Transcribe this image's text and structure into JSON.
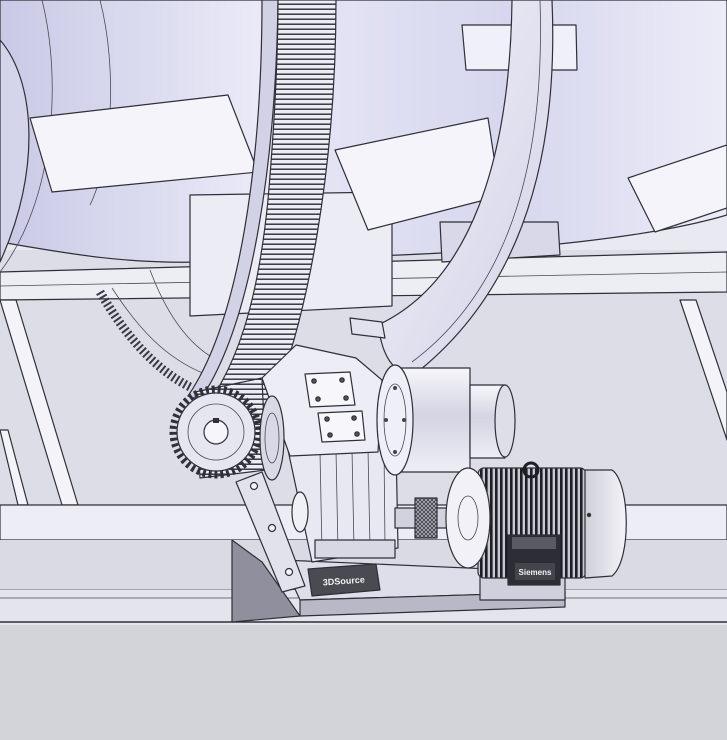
{
  "labels": {
    "base_plate_logo": "3DSource",
    "motor_nameplate": "Siemens"
  },
  "colors": {
    "steel_light": "#ececf6",
    "steel_shadow": "#c6c6e0",
    "motor_body": "#1e1e24",
    "floor": "#d3d4da",
    "outline": "#2f2f37"
  }
}
